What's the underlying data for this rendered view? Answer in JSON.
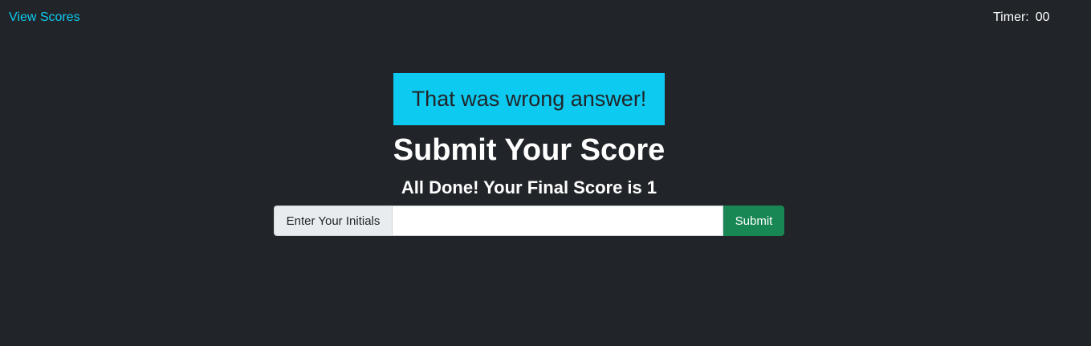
{
  "nav": {
    "view_scores_label": "View Scores",
    "timer_label": "Timer:",
    "timer_value": "00"
  },
  "feedback": {
    "message": "That was wrong answer!"
  },
  "main": {
    "title": "Submit Your Score",
    "final_score_text": "All Done! Your Final Score is 1"
  },
  "form": {
    "addon_label": "Enter Your Initials",
    "input_value": "",
    "input_placeholder": "",
    "submit_label": "Submit"
  },
  "colors": {
    "background": "#212529",
    "accent_info": "#0dcaf0",
    "success": "#198754",
    "text": "#ffffff"
  }
}
